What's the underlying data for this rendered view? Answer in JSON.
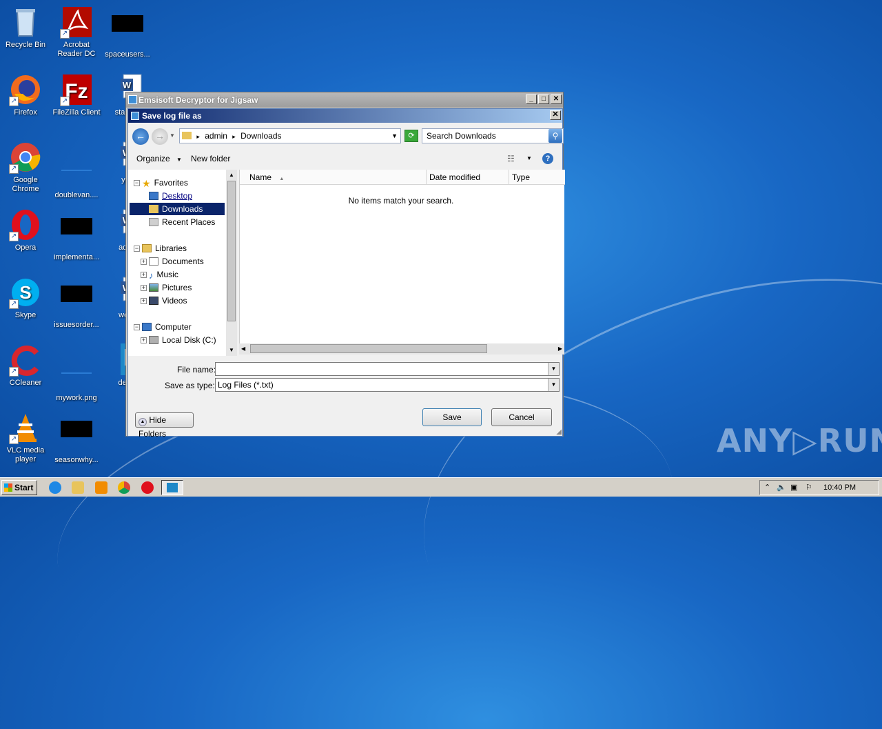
{
  "desktop": {
    "icons": [
      {
        "label": "Recycle Bin"
      },
      {
        "label": "Acrobat Reader DC"
      },
      {
        "label": "spaceusers..."
      },
      {
        "label": "Firefox"
      },
      {
        "label": "FileZilla Client"
      },
      {
        "label": "starte..."
      },
      {
        "label": "Google Chrome"
      },
      {
        "label": "doublevan...."
      },
      {
        "label": "yah"
      },
      {
        "label": "Opera"
      },
      {
        "label": "implementa..."
      },
      {
        "label": "advic"
      },
      {
        "label": "Skype"
      },
      {
        "label": "issuesorder..."
      },
      {
        "label": "week"
      },
      {
        "label": "CCleaner"
      },
      {
        "label": "mywork.png"
      },
      {
        "label": "decry"
      },
      {
        "label": "VLC media player"
      },
      {
        "label": "seasonwhy..."
      }
    ],
    "watermark": "ANY▷RUN"
  },
  "outer_window": {
    "title": "Emsisoft Decryptor for Jigsaw",
    "controls": {
      "minimize": "_",
      "maximize": "□",
      "close": "✕"
    }
  },
  "dialog": {
    "title": "Save log file as",
    "close": "✕",
    "breadcrumb": [
      "admin",
      "Downloads"
    ],
    "breadcrumb_sep": "▸",
    "search_placeholder": "Search Downloads",
    "toolbar": {
      "organize": "Organize",
      "new_folder": "New folder"
    },
    "nav": {
      "favorites": "Favorites",
      "desktop": "Desktop",
      "downloads": "Downloads",
      "recent_places": "Recent Places",
      "libraries": "Libraries",
      "documents": "Documents",
      "music": "Music",
      "pictures": "Pictures",
      "videos": "Videos",
      "computer": "Computer",
      "local_disk": "Local Disk (C:)"
    },
    "columns": {
      "name": "Name",
      "date_modified": "Date modified",
      "type": "Type"
    },
    "empty_message": "No items match your search.",
    "file_name_label": "File name:",
    "file_name_value": "",
    "save_as_type_label": "Save as type:",
    "save_as_type_value": "Log Files (*.txt)",
    "hide_folders": "Hide Folders",
    "save": "Save",
    "cancel": "Cancel"
  },
  "taskbar": {
    "start": "Start",
    "clock": "10:40 PM"
  },
  "colors": {
    "desktop_blue": "#1867c4",
    "dialog_title": "#0a246a",
    "selection": "#0a246a"
  }
}
